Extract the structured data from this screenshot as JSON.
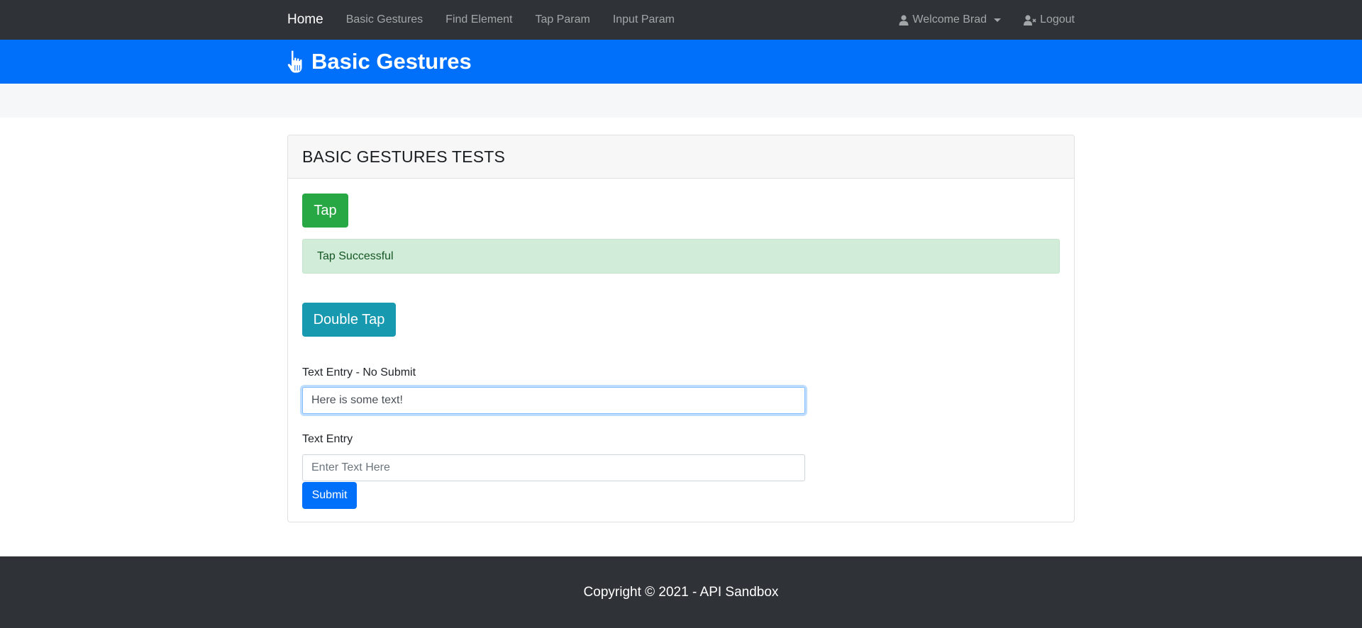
{
  "navbar": {
    "brand": "Home",
    "links": [
      "Basic Gestures",
      "Find Element",
      "Tap Param",
      "Input Param"
    ],
    "user_label": "Welcome Brad",
    "logout_label": "Logout",
    "icons": {
      "user": "user-icon",
      "logout": "user-times-icon",
      "dropdown": "caret-down-icon"
    }
  },
  "hero": {
    "title": "Basic Gestures",
    "icon": "hand-pointer-icon"
  },
  "card": {
    "title": "BASIC GESTURES TESTS",
    "tap_label": "Tap",
    "alert_text": "Tap Successful",
    "double_tap_label": "Double Tap",
    "text_entry_no_submit_label": "Text Entry - No Submit",
    "text_entry_no_submit_value": "Here is some text!",
    "text_entry_label": "Text Entry",
    "text_entry_placeholder": "Enter Text Here",
    "submit_label": "Submit"
  },
  "footer": {
    "text": "Copyright © 2021 - API Sandbox"
  },
  "colors": {
    "navbar": "#2f3337",
    "primary": "#0070fb",
    "success": "#28a745",
    "info": "#1799b0",
    "alert_bg": "#d1ecd8"
  }
}
